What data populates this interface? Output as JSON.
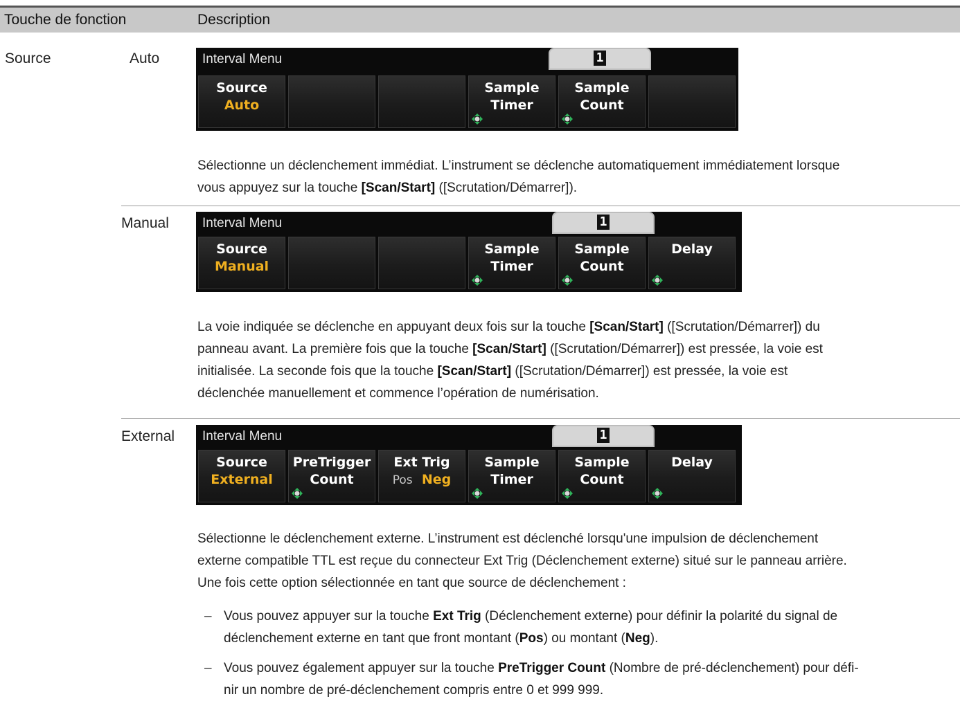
{
  "table": {
    "col1_header": "Touche de fonction",
    "col2_header": "Description"
  },
  "row_label": "Source",
  "auto": {
    "label": "Auto",
    "panel": {
      "title": "Interval Menu",
      "tab_value": "1",
      "keys": {
        "source_top": "Source",
        "source_value": "Auto",
        "sample_timer_top": "Sample",
        "sample_timer_bottom": "Timer",
        "sample_count_top": "Sample",
        "sample_count_bottom": "Count"
      }
    },
    "para_1": "Sélectionne un déclenchement immédiat. L’instrument se déclenche automatiquement immédiatement lorsque",
    "para_2a": "vous appuyez sur la touche ",
    "para_2b": "[Scan/Start]",
    "para_2c": " ([Scrutation/Démarrer])."
  },
  "manual": {
    "label": "Manual",
    "panel": {
      "title": "Interval Menu",
      "tab_value": "1",
      "keys": {
        "source_top": "Source",
        "source_value": "Manual",
        "sample_timer_top": "Sample",
        "sample_timer_bottom": "Timer",
        "sample_count_top": "Sample",
        "sample_count_bottom": "Count",
        "delay_top": "Delay"
      }
    },
    "l1a": "La voie indiquée se déclenche en appuyant deux fois sur la touche ",
    "l1b": "[Scan/Start]",
    "l1c": " ([Scrutation/Démarrer]) du",
    "l2a": "panneau avant. La première fois que la touche ",
    "l2b": "[Scan/Start]",
    "l2c": " ([Scrutation/Démarrer]) est pressée, la voie est",
    "l3a": "initialisée. La seconde fois que la touche ",
    "l3b": "[Scan/Start]",
    "l3c": " ([Scrutation/Démarrer]) est pressée, la voie est",
    "l4": "déclenchée manuellement et commence l’opération de numérisation."
  },
  "external": {
    "label": "External",
    "panel": {
      "title": "Interval Menu",
      "tab_value": "1",
      "keys": {
        "source_top": "Source",
        "source_value": "External",
        "pretrigger_top": "PreTrigger",
        "pretrigger_bottom": "Count",
        "exttrig_top": "Ext Trig",
        "exttrig_pos": "Pos",
        "exttrig_neg": "Neg",
        "sample_timer_top": "Sample",
        "sample_timer_bottom": "Timer",
        "sample_count_top": "Sample",
        "sample_count_bottom": "Count",
        "delay_top": "Delay"
      }
    },
    "p1": "Sélectionne le déclenchement externe. L’instrument est déclenché lorsqu'une impulsion de déclenchement",
    "p2": "externe compatible TTL est reçue du connecteur Ext Trig (Déclenchement externe) situé sur le panneau arrière.",
    "p3": "Une fois cette option sélectionnée en tant que source de déclenchement :",
    "bullet1": {
      "dash": "–",
      "a": "Vous pouvez appuyer sur la touche ",
      "b": "Ext Trig",
      "c": " (Déclenchement externe) pour définir la polarité du signal de",
      "d": "déclenchement externe en tant que front montant (",
      "e": "Pos",
      "f": ") ou montant (",
      "g": "Neg",
      "h": ")."
    },
    "bullet2": {
      "dash": "–",
      "a": "Vous pouvez également appuyer sur la touche ",
      "b": "PreTrigger Count",
      "c": " (Nombre de pré-déclenchement) pour défi-",
      "d": "nir un nombre de pré-déclenchement compris entre 0 et 999 999."
    }
  },
  "colors": {
    "header_bg": "#c8c8c8",
    "panel_bg": "#0b0b0b",
    "value_accent": "#f0b020",
    "knob_green": "#2fb35a"
  }
}
